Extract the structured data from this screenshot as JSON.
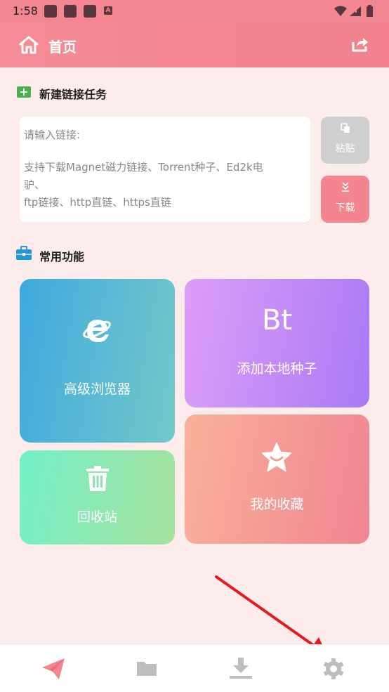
{
  "status_bar": {
    "time": "1:58",
    "badge": "A"
  },
  "app_bar": {
    "title": "首页"
  },
  "new_task": {
    "section_title": "新建链接任务",
    "input_lines": [
      "请输入链接:",
      "支持下载Magnet磁力链接、Torrent种子、Ed2k电",
      "驴、",
      "ftp链接、http直链、https直链"
    ],
    "paste_label": "粘贴",
    "download_label": "下载"
  },
  "features": {
    "section_title": "常用功能",
    "browser_label": "高级浏览器",
    "bt_text": "Bt",
    "bt_label": "添加本地种子",
    "recycle_label": "回收站",
    "favorites_label": "我的收藏"
  },
  "bottom_nav": [
    "send-icon",
    "folder-icon",
    "download-icon",
    "settings-gear-icon"
  ],
  "colors": {
    "primary": "#f2878f",
    "background": "#fdecec"
  }
}
